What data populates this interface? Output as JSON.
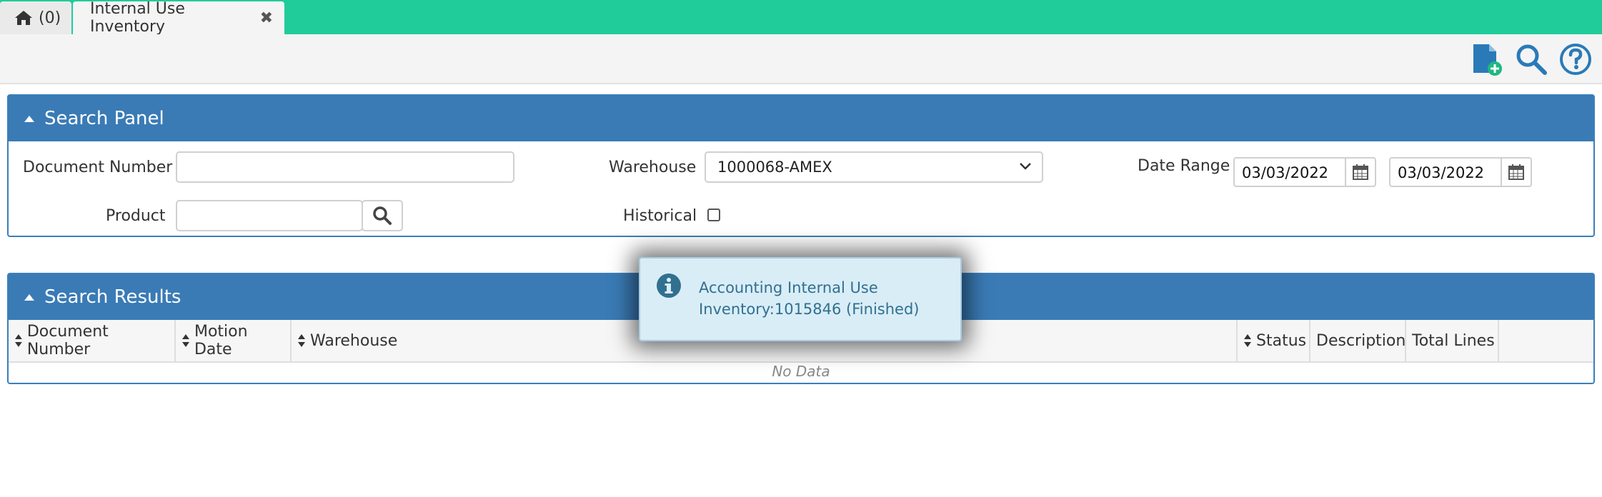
{
  "tabs": {
    "home_count": "(0)",
    "active_label": "Internal Use Inventory",
    "close_symbol": "✖"
  },
  "toolbar": {
    "icons": [
      "new-document-icon",
      "search-icon",
      "help-icon"
    ],
    "accent_color": "#2a7ab8"
  },
  "search_panel": {
    "title": "Search Panel",
    "document_number_label": "Document Number",
    "document_number_value": "",
    "product_label": "Product",
    "product_value": "",
    "warehouse_label": "Warehouse",
    "warehouse_value": "1000068-AMEX",
    "historical_label": "Historical",
    "historical_checked": false,
    "date_range_label": "Date Range",
    "date_from": "03/03/2022",
    "date_to": "03/03/2022"
  },
  "search_results": {
    "title": "Search Results",
    "columns": [
      "Document Number",
      "Motion Date",
      "Warehouse",
      "Status",
      "Description",
      "Total Lines"
    ],
    "empty_text": "No Data"
  },
  "notification": {
    "message": "Accounting Internal Use Inventory:1015846 (Finished)",
    "icon": "info-icon"
  },
  "colors": {
    "tabbar": "#20cc9a",
    "panel_header": "#3a7bb6",
    "toast_bg": "#d9edf7",
    "toast_text": "#31708f"
  }
}
